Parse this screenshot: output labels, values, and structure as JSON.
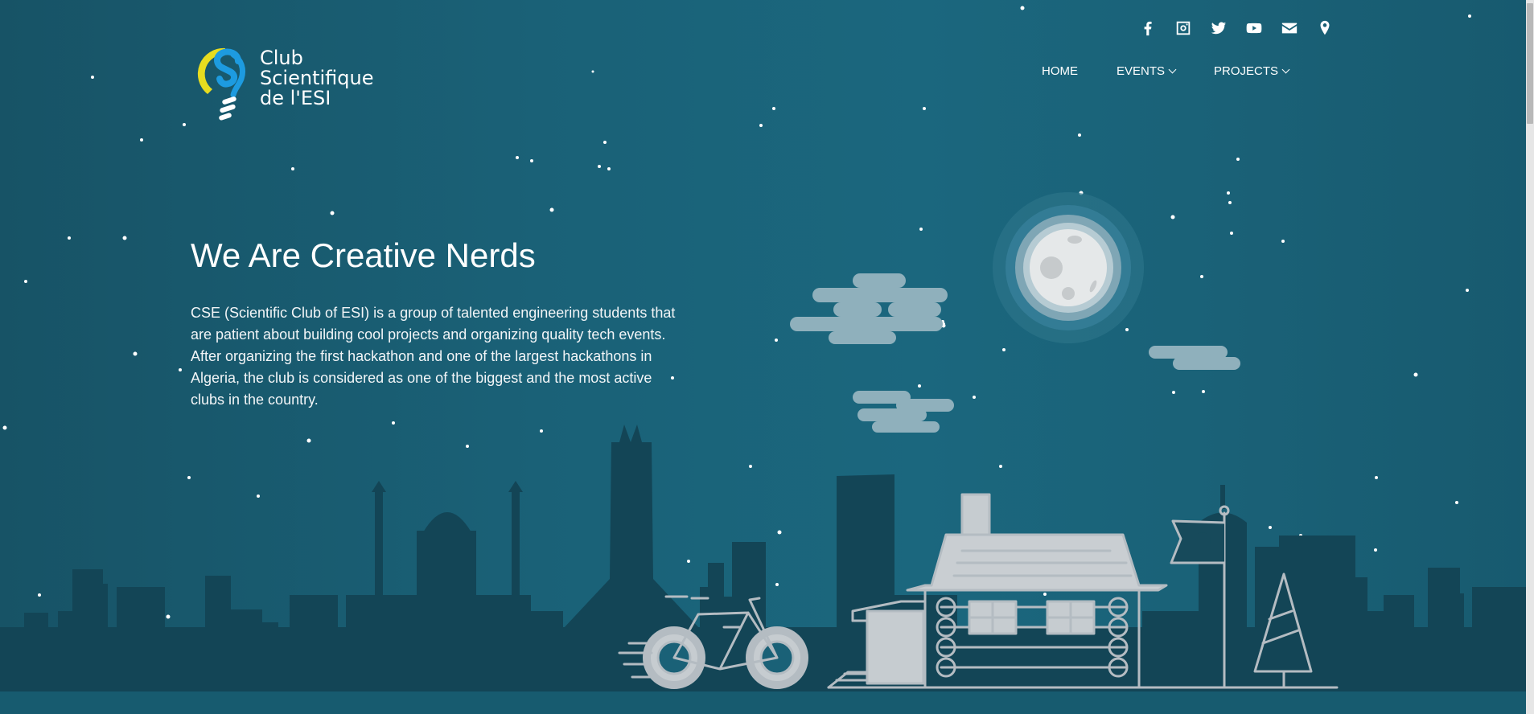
{
  "logo": {
    "line1": "Club",
    "line2": "Scientifique",
    "line3": "de l'ESI"
  },
  "social_icons": [
    "facebook-icon",
    "instagram-icon",
    "twitter-icon",
    "youtube-icon",
    "email-icon",
    "map-marker-icon"
  ],
  "nav": {
    "home": "HOME",
    "events": "EVENTS",
    "projects": "PROJECTS"
  },
  "hero": {
    "title": "We Are Creative Nerds",
    "description": "CSE (Scientific Club of ESI) is a group of talented engineering students that are patient about building cool projects and organizing quality tech events. After organizing the first hackathon and one of the largest hackathons in Algeria, the club is considered as one of the biggest and the most active clubs in the country."
  },
  "colors": {
    "background": "#1a6177",
    "skyline": "#134556",
    "drawing": "#b4bcc2",
    "logo_blue": "#1d9be0",
    "logo_yellow": "#e7dc1f"
  }
}
